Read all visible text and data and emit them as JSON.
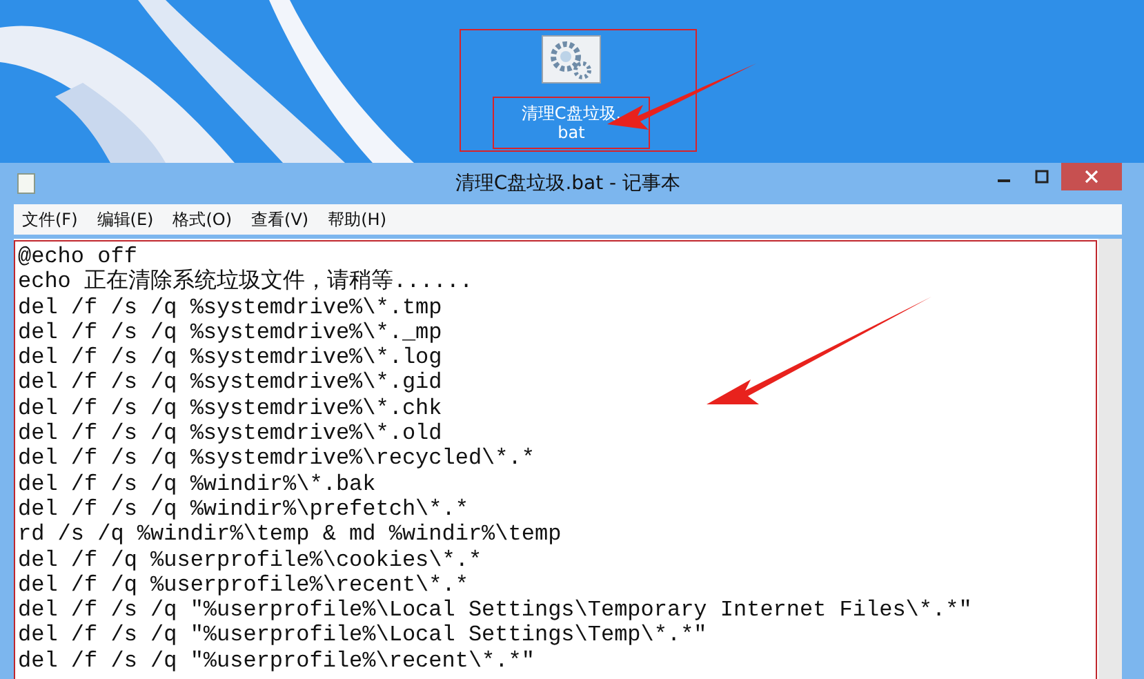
{
  "desktop": {
    "icon": {
      "label": "清理C盘垃圾.bat"
    }
  },
  "window": {
    "title": "清理C盘垃圾.bat - 记事本"
  },
  "menu": [
    "文件(F)",
    "编辑(E)",
    "格式(O)",
    "查看(V)",
    "帮助(H)"
  ],
  "lines": [
    "@echo off",
    "echo 正在清除系统垃圾文件，请稍等......",
    "del /f /s /q %systemdrive%\\*.tmp",
    "del /f /s /q %systemdrive%\\*._mp",
    "del /f /s /q %systemdrive%\\*.log",
    "del /f /s /q %systemdrive%\\*.gid",
    "del /f /s /q %systemdrive%\\*.chk",
    "del /f /s /q %systemdrive%\\*.old",
    "del /f /s /q %systemdrive%\\recycled\\*.*",
    "del /f /s /q %windir%\\*.bak",
    "del /f /s /q %windir%\\prefetch\\*.*",
    "rd /s /q %windir%\\temp & md %windir%\\temp",
    "del /f /q %userprofile%\\cookies\\*.*",
    "del /f /q %userprofile%\\recent\\*.*",
    "del /f /s /q \"%userprofile%\\Local Settings\\Temporary Internet Files\\*.*\"",
    "del /f /s /q \"%userprofile%\\Local Settings\\Temp\\*.*\"",
    "del /f /s /q \"%userprofile%\\recent\\*.*\""
  ]
}
